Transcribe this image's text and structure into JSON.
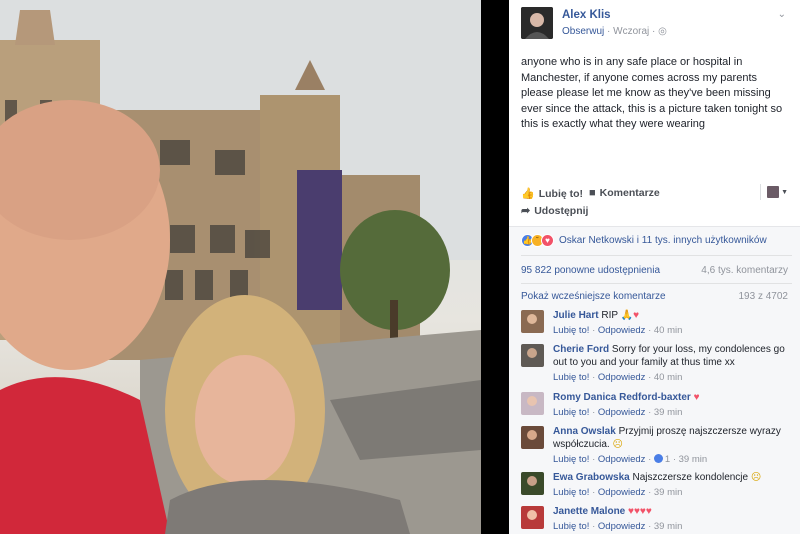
{
  "post": {
    "author": "Alex Klis",
    "follow": "Obserwuj",
    "time": "Wczoraj",
    "globe_icon": "globe-icon",
    "text": "anyone who is in any safe place or hospital in Manchester, if anyone comes across my parents please please let me know as they've been missing ever since the attack, this is a picture taken tonight so this is exactly what they were wearing"
  },
  "actions": {
    "like": "Lubię to!",
    "comment": "Komentarze",
    "share": "Udostępnij"
  },
  "reactions": {
    "text": "Oskar Netkowski i 11 tys. innych użytkowników",
    "shares": "95 822 ponowne udostępnienia",
    "comments": "4,6 tys. komentarzy"
  },
  "previous": {
    "label": "Pokaż wcześniejsze komentarze",
    "count": "193 z 4702"
  },
  "comments": [
    {
      "name": "Julie Hart",
      "text": "RIP",
      "like": "Lubię to!",
      "reply": "Odpowiedz",
      "time": "40 min",
      "likes": ""
    },
    {
      "name": "Cherie Ford",
      "text": "Sorry for your loss, my condolences go out to you and your family at thus time xx",
      "like": "Lubię to!",
      "reply": "Odpowiedz",
      "time": "40 min",
      "likes": ""
    },
    {
      "name": "Romy Danica Redford-baxter",
      "text": "",
      "like": "Lubię to!",
      "reply": "Odpowiedz",
      "time": "39 min",
      "likes": ""
    },
    {
      "name": "Anna Owslak",
      "text": "Przyjmij proszę najszczersze wyrazy współczucia.",
      "like": "Lubię to!",
      "reply": "Odpowiedz",
      "time": "39 min",
      "likes": "1"
    },
    {
      "name": "Ewa Grabowska",
      "text": "Najszczersze kondolencje",
      "like": "Lubię to!",
      "reply": "Odpowiedz",
      "time": "39 min",
      "likes": ""
    },
    {
      "name": "Janette Malone",
      "text": "",
      "like": "Lubię to!",
      "reply": "Odpowiedz",
      "time": "39 min",
      "likes": ""
    }
  ],
  "colors": {
    "link": "#365899",
    "muted": "#90949c",
    "text": "#1d2129",
    "heart": "#f25268"
  }
}
